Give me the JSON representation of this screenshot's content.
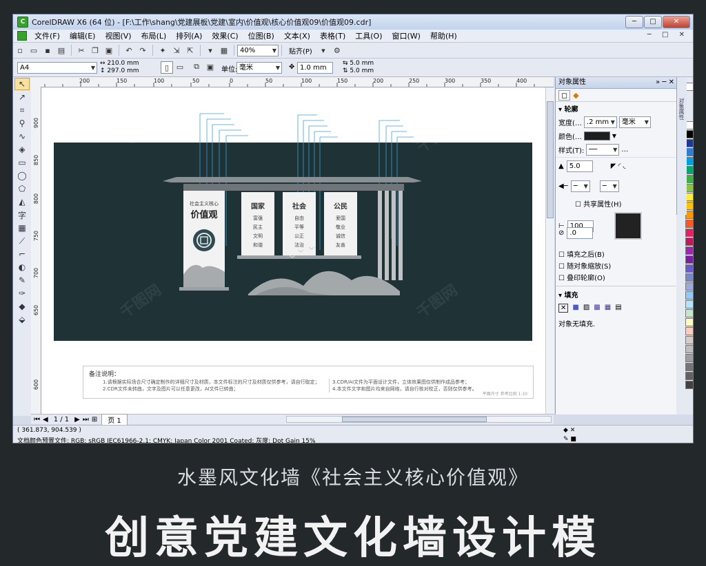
{
  "window": {
    "title": "CorelDRAW X6 (64 位) - [F:\\工作\\shang\\党建展板\\党建\\室内\\价值观\\核心价值观09\\价值观09.cdr]"
  },
  "menu": [
    "文件(F)",
    "编辑(E)",
    "视图(V)",
    "布局(L)",
    "排列(A)",
    "效果(C)",
    "位图(B)",
    "文本(X)",
    "表格(T)",
    "工具(O)",
    "窗口(W)",
    "帮助(H)"
  ],
  "toolbar": {
    "zoom": "40%",
    "snap": "贴齐(P)"
  },
  "propbar": {
    "page_size": "A4",
    "width": "210.0 mm",
    "height": "297.0 mm",
    "unit_label": "单位:",
    "unit": "毫米",
    "nudge": "1.0 mm",
    "dup_x": "5.0 mm",
    "dup_y": "5.0 mm"
  },
  "ruler": {
    "h": [
      "200",
      "150",
      "100",
      "50",
      "0",
      "50",
      "100",
      "150",
      "200",
      "250",
      "300",
      "350",
      "400"
    ],
    "v": [
      "900",
      "850",
      "800",
      "750",
      "700",
      "650",
      "600"
    ]
  },
  "artwork": {
    "panel1_small": "社会主义核心",
    "panel1_big": "价值观",
    "panel2_title": "国家",
    "panel2_lines": [
      "富强",
      "民主",
      "文明",
      "和谐"
    ],
    "panel3_title": "社会",
    "panel3_lines": [
      "自由",
      "平等",
      "公正",
      "法治"
    ],
    "panel4_title": "公民",
    "panel4_lines": [
      "爱国",
      "敬业",
      "诚信",
      "友善"
    ]
  },
  "note": {
    "title": "备注说明：",
    "left": [
      "1.请根据实际场合尺寸确定制作的详细尺寸及材质，本文件标注的尺寸及材质仅供参考，请自行取定；",
      "2.CDR文件未转曲，文字及图片可以任意更改，AI文件已转曲；"
    ],
    "right": [
      "3.CDR/AI文件为平面设计文件，立体效果图仅供制作成品参考；",
      "4.本文件文字和图片均来自网络，请自行核对校正，否则仅供参考。"
    ],
    "scale": "平面尺寸 参考比例 1:10"
  },
  "pagebar": {
    "page_count": "1 / 1",
    "page_tab": "页 1"
  },
  "status": {
    "coords": "( 361.873, 904.539 )",
    "color_profile": "文档颜色预置文件: RGB: sRGB IEC61966-2.1; CMYK: Japan Color 2001 Coated; 灰度: Dot Gain 15%"
  },
  "docker": {
    "title": "对象属性",
    "outline": "轮廓",
    "width_label": "宽度(…",
    "width_val": ".2 mm",
    "width_unit": "毫米",
    "color_label": "颜色(…",
    "style_label": "样式(T):",
    "miter": "5.0",
    "share": "共享属性(H)",
    "stretch": "100",
    "angle": ".0",
    "behind_fill": "填充之后(B)",
    "scale_with": "随对象缩放(S)",
    "overprint": "叠印轮廓(O)",
    "fill": "填充",
    "no_fill": "对象无填充."
  },
  "palette": [
    "#ffffff",
    "#000000",
    "#1f3a93",
    "#2c7fd4",
    "#00a0e0",
    "#00a86b",
    "#3cb043",
    "#8bc34a",
    "#ffeb3b",
    "#ffc107",
    "#ff9800",
    "#ff5722",
    "#e91e63",
    "#c2185b",
    "#9c27b0",
    "#7b1fa2",
    "#6a5acd",
    "#7986cb",
    "#9fa8da",
    "#90caf9",
    "#b3e5fc",
    "#c8e6c9",
    "#fff9c4",
    "#ffccbc",
    "#d7ccc8",
    "#bdbdbd",
    "#9e9e9e",
    "#757575",
    "#616161",
    "#424242"
  ],
  "caption": "水墨风文化墙《社会主义核心价值观》",
  "big_caption": "创意党建文化墙设计模"
}
